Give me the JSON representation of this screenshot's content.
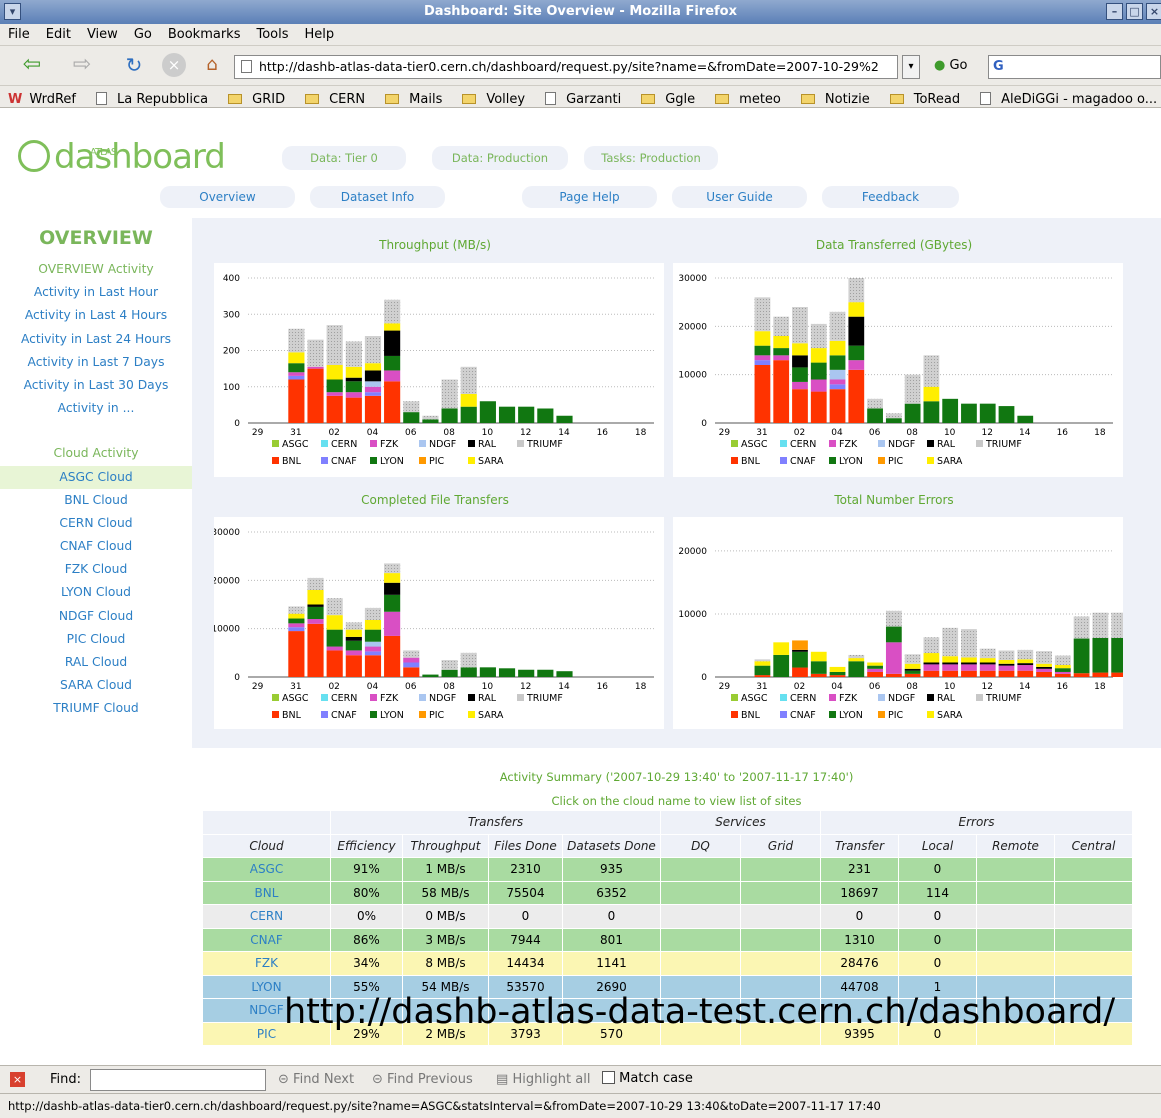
{
  "window": {
    "title": "Dashboard: Site Overview - Mozilla Firefox"
  },
  "menu": [
    "File",
    "Edit",
    "View",
    "Go",
    "Bookmarks",
    "Tools",
    "Help"
  ],
  "nav": {
    "url": "http://dashb-atlas-data-tier0.cern.ch/dashboard/request.py/site?name=&fromDate=2007-10-29%2",
    "go_label": "Go",
    "search_value": "G"
  },
  "bookmarks": [
    {
      "label": "WrdRef",
      "icon": "wr-icon"
    },
    {
      "label": "La Repubblica",
      "icon": "page-icon"
    },
    {
      "label": "GRID",
      "icon": "folder-icon"
    },
    {
      "label": "CERN",
      "icon": "folder-icon"
    },
    {
      "label": "Mails",
      "icon": "folder-icon"
    },
    {
      "label": "Volley",
      "icon": "folder-icon"
    },
    {
      "label": "Garzanti",
      "icon": "page-icon"
    },
    {
      "label": "Ggle",
      "icon": "folder-icon"
    },
    {
      "label": "meteo",
      "icon": "folder-icon"
    },
    {
      "label": "Notizie",
      "icon": "folder-icon"
    },
    {
      "label": "ToRead",
      "icon": "folder-icon"
    },
    {
      "label": "AleDiGGi - magadoo o...",
      "icon": "page-icon"
    }
  ],
  "logo": {
    "small": "ATLAS",
    "text": "dashboard"
  },
  "top_tabs": [
    "Data: Tier 0",
    "Data: Production",
    "Tasks: Production"
  ],
  "nav_tabs": [
    "Overview",
    "Dataset Info",
    "Page Help",
    "User Guide",
    "Feedback"
  ],
  "sidebar": {
    "heading": "OVERVIEW",
    "overview_title": "OVERVIEW Activity",
    "overview_items": [
      "Activity in Last Hour",
      "Activity in Last 4 Hours",
      "Activity in Last 24 Hours",
      "Activity in Last 7 Days",
      "Activity in Last 30 Days",
      "Activity in ..."
    ],
    "cloud_title": "Cloud Activity",
    "cloud_items": [
      "ASGC Cloud",
      "BNL Cloud",
      "CERN Cloud",
      "CNAF Cloud",
      "FZK Cloud",
      "LYON Cloud",
      "NDGF Cloud",
      "PIC Cloud",
      "RAL Cloud",
      "SARA Cloud",
      "TRIUMF Cloud"
    ],
    "selected": "ASGC Cloud"
  },
  "colors": {
    "BNL": "#ff3300",
    "CNAF": "#8080ff",
    "LYON": "#117711",
    "PIC": "#ff9900",
    "SARA": "#ffee00",
    "ASGC": "#99cc33",
    "CERN": "#66e0f0",
    "FZK": "#d94fc4",
    "NDGF": "#aac6f0",
    "RAL": "#000000",
    "TRIUMF": "#c8c8c8"
  },
  "chart_data": [
    {
      "type": "bar",
      "title": "Throughput (MB/s)",
      "x_ticks": [
        "29",
        "31",
        "02",
        "04",
        "06",
        "08",
        "10",
        "12",
        "14",
        "16",
        "18"
      ],
      "y_ticks": [
        0,
        100,
        200,
        300,
        400
      ],
      "ylim": [
        0,
        400
      ],
      "grid": true,
      "legend": "bottom",
      "legend_rows": [
        [
          "ASGC",
          "CERN",
          "FZK",
          "NDGF",
          "RAL",
          "TRIUMF"
        ],
        [
          "BNL",
          "CNAF",
          "LYON",
          "PIC",
          "SARA"
        ]
      ],
      "stacks": [
        {
          "day": "31",
          "BNL": 120,
          "CNAF": 10,
          "FZK": 10,
          "LYON": 25,
          "SARA": 30,
          "TRIUMF": 65
        },
        {
          "day": "01",
          "BNL": 150,
          "FZK": 5,
          "TRIUMF": 75
        },
        {
          "day": "02",
          "BNL": 75,
          "FZK": 10,
          "LYON": 35,
          "SARA": 40,
          "TRIUMF": 110
        },
        {
          "day": "03",
          "BNL": 70,
          "FZK": 15,
          "LYON": 30,
          "RAL": 10,
          "SARA": 30,
          "TRIUMF": 70
        },
        {
          "day": "04",
          "BNL": 75,
          "CNAF": 10,
          "FZK": 15,
          "NDGF": 15,
          "RAL": 30,
          "SARA": 20,
          "TRIUMF": 75
        },
        {
          "day": "05",
          "BNL": 115,
          "FZK": 30,
          "LYON": 40,
          "RAL": 70,
          "SARA": 20,
          "TRIUMF": 65
        },
        {
          "day": "06",
          "LYON": 30,
          "TRIUMF": 30
        },
        {
          "day": "07",
          "LYON": 10,
          "TRIUMF": 10
        },
        {
          "day": "08",
          "LYON": 40,
          "TRIUMF": 80
        },
        {
          "day": "09",
          "LYON": 45,
          "SARA": 35,
          "TRIUMF": 75
        },
        {
          "day": "10",
          "LYON": 60
        },
        {
          "day": "11",
          "LYON": 45
        },
        {
          "day": "12",
          "LYON": 45
        },
        {
          "day": "13",
          "LYON": 40
        },
        {
          "day": "14",
          "LYON": 20
        }
      ]
    },
    {
      "type": "bar",
      "title": "Data Transferred (GBytes)",
      "x_ticks": [
        "29",
        "31",
        "02",
        "04",
        "06",
        "08",
        "10",
        "12",
        "14",
        "16",
        "18"
      ],
      "y_ticks": [
        0,
        10000,
        20000,
        30000
      ],
      "ylim": [
        0,
        30000
      ],
      "grid": true,
      "legend": "bottom",
      "legend_rows": [
        [
          "ASGC",
          "CERN",
          "FZK",
          "NDGF",
          "RAL",
          "TRIUMF"
        ],
        [
          "BNL",
          "CNAF",
          "LYON",
          "PIC",
          "SARA"
        ]
      ],
      "stacks": [
        {
          "day": "31",
          "BNL": 12000,
          "CNAF": 1000,
          "FZK": 1000,
          "LYON": 2000,
          "SARA": 3000,
          "TRIUMF": 7000
        },
        {
          "day": "01",
          "BNL": 13000,
          "FZK": 1000,
          "LYON": 1500,
          "SARA": 2500,
          "TRIUMF": 4000
        },
        {
          "day": "02",
          "BNL": 7000,
          "FZK": 1500,
          "LYON": 3000,
          "RAL": 2500,
          "SARA": 2500,
          "TRIUMF": 7500
        },
        {
          "day": "03",
          "BNL": 6500,
          "FZK": 2500,
          "LYON": 3500,
          "SARA": 3000,
          "TRIUMF": 5000
        },
        {
          "day": "04",
          "BNL": 7000,
          "CNAF": 1000,
          "FZK": 1000,
          "NDGF": 2000,
          "LYON": 3000,
          "SARA": 3000,
          "TRIUMF": 6000
        },
        {
          "day": "05",
          "BNL": 11000,
          "FZK": 2000,
          "LYON": 3000,
          "RAL": 6000,
          "SARA": 3000,
          "TRIUMF": 5000
        },
        {
          "day": "06",
          "LYON": 3000,
          "TRIUMF": 2000
        },
        {
          "day": "07",
          "LYON": 1000,
          "TRIUMF": 1000
        },
        {
          "day": "08",
          "LYON": 4000,
          "TRIUMF": 6000
        },
        {
          "day": "09",
          "LYON": 4500,
          "SARA": 3000,
          "TRIUMF": 6500
        },
        {
          "day": "10",
          "LYON": 5000
        },
        {
          "day": "11",
          "LYON": 4000
        },
        {
          "day": "12",
          "LYON": 4000
        },
        {
          "day": "13",
          "LYON": 3500
        },
        {
          "day": "14",
          "LYON": 1500
        }
      ]
    },
    {
      "type": "bar",
      "title": "Completed File Transfers",
      "x_ticks": [
        "29",
        "31",
        "02",
        "04",
        "06",
        "08",
        "10",
        "12",
        "14",
        "16",
        "18"
      ],
      "y_ticks": [
        0,
        10000,
        20000,
        30000
      ],
      "ylim": [
        0,
        30000
      ],
      "grid": true,
      "legend": "bottom",
      "legend_rows": [
        [
          "ASGC",
          "CERN",
          "FZK",
          "NDGF",
          "RAL",
          "TRIUMF"
        ],
        [
          "BNL",
          "CNAF",
          "LYON",
          "PIC",
          "SARA"
        ]
      ],
      "stacks": [
        {
          "day": "31",
          "BNL": 9500,
          "CNAF": 800,
          "FZK": 800,
          "LYON": 1000,
          "SARA": 1000,
          "TRIUMF": 1500
        },
        {
          "day": "01",
          "BNL": 11000,
          "FZK": 1000,
          "LYON": 2500,
          "SARA": 3000,
          "RAL": 500,
          "TRIUMF": 2500
        },
        {
          "day": "02",
          "BNL": 5500,
          "FZK": 800,
          "LYON": 3500,
          "SARA": 3000,
          "TRIUMF": 3500
        },
        {
          "day": "03",
          "BNL": 4500,
          "FZK": 1000,
          "LYON": 2000,
          "RAL": 800,
          "SARA": 1500,
          "TRIUMF": 1500
        },
        {
          "day": "04",
          "BNL": 4500,
          "CNAF": 800,
          "FZK": 1000,
          "NDGF": 1000,
          "LYON": 2500,
          "SARA": 2000,
          "TRIUMF": 2500
        },
        {
          "day": "05",
          "BNL": 8500,
          "FZK": 5000,
          "LYON": 3500,
          "RAL": 2500,
          "SARA": 2000,
          "TRIUMF": 2000
        },
        {
          "day": "06",
          "BNL": 2000,
          "CNAF": 1000,
          "FZK": 1000,
          "TRIUMF": 1500
        },
        {
          "day": "07",
          "LYON": 500
        },
        {
          "day": "08",
          "LYON": 1500,
          "TRIUMF": 2000
        },
        {
          "day": "09",
          "LYON": 2000,
          "TRIUMF": 3000
        },
        {
          "day": "10",
          "LYON": 2000
        },
        {
          "day": "11",
          "LYON": 1800
        },
        {
          "day": "12",
          "LYON": 1500
        },
        {
          "day": "13",
          "LYON": 1500
        },
        {
          "day": "14",
          "LYON": 1200
        }
      ]
    },
    {
      "type": "bar",
      "title": "Total Number Errors",
      "x_ticks": [
        "29",
        "31",
        "02",
        "04",
        "06",
        "08",
        "10",
        "12",
        "14",
        "16",
        "18"
      ],
      "y_ticks": [
        0,
        10000,
        20000
      ],
      "ylim": [
        0,
        23000
      ],
      "grid": true,
      "legend": "bottom",
      "legend_rows": [
        [
          "ASGC",
          "CERN",
          "FZK",
          "NDGF",
          "RAL",
          "TRIUMF"
        ],
        [
          "BNL",
          "CNAF",
          "LYON",
          "PIC",
          "SARA"
        ]
      ],
      "stacks": [
        {
          "day": "31",
          "BNL": 300,
          "LYON": 1500,
          "SARA": 700,
          "TRIUMF": 300
        },
        {
          "day": "01",
          "LYON": 3500,
          "SARA": 2000
        },
        {
          "day": "02",
          "BNL": 1500,
          "LYON": 2500,
          "PIC": 1500,
          "RAL": 300
        },
        {
          "day": "03",
          "BNL": 500,
          "LYON": 2000,
          "SARA": 1500
        },
        {
          "day": "04",
          "BNL": 300,
          "LYON": 500,
          "SARA": 800
        },
        {
          "day": "05",
          "LYON": 2500,
          "SARA": 500,
          "TRIUMF": 500
        },
        {
          "day": "06",
          "BNL": 800,
          "FZK": 500,
          "LYON": 500,
          "SARA": 500
        },
        {
          "day": "07",
          "BNL": 500,
          "FZK": 5000,
          "LYON": 2500,
          "TRIUMF": 2500
        },
        {
          "day": "08",
          "BNL": 500,
          "LYON": 500,
          "RAL": 300,
          "SARA": 800,
          "TRIUMF": 1500
        },
        {
          "day": "09",
          "BNL": 1000,
          "FZK": 1000,
          "RAL": 300,
          "SARA": 1500,
          "TRIUMF": 2500
        },
        {
          "day": "10",
          "BNL": 1000,
          "FZK": 1000,
          "RAL": 300,
          "SARA": 1000,
          "TRIUMF": 4500
        },
        {
          "day": "11",
          "BNL": 1000,
          "FZK": 1000,
          "RAL": 300,
          "SARA": 800,
          "TRIUMF": 4500
        },
        {
          "day": "12",
          "BNL": 1000,
          "FZK": 1000,
          "RAL": 300,
          "SARA": 700,
          "TRIUMF": 1500
        },
        {
          "day": "13",
          "BNL": 1000,
          "FZK": 800,
          "RAL": 300,
          "SARA": 600,
          "TRIUMF": 1500
        },
        {
          "day": "14",
          "BNL": 1000,
          "FZK": 900,
          "RAL": 300,
          "SARA": 600,
          "TRIUMF": 1500
        },
        {
          "day": "15",
          "BNL": 800,
          "FZK": 500,
          "RAL": 300,
          "SARA": 500,
          "TRIUMF": 2000
        },
        {
          "day": "16",
          "BNL": 500,
          "FZK": 300,
          "LYON": 600,
          "SARA": 500,
          "TRIUMF": 1500
        },
        {
          "day": "17",
          "BNL": 600,
          "LYON": 5500,
          "TRIUMF": 3500
        },
        {
          "day": "18",
          "BNL": 700,
          "LYON": 5500,
          "TRIUMF": 4000
        },
        {
          "day": "19",
          "BNL": 700,
          "LYON": 5500,
          "TRIUMF": 4000
        }
      ]
    }
  ],
  "summary": {
    "title": "Activity Summary ('2007-10-29 13:40' to '2007-11-17 17:40')",
    "subtitle": "Click on the cloud name to view list of sites",
    "groups": [
      "",
      "Transfers",
      "Services",
      "Errors"
    ],
    "columns": [
      "Cloud",
      "Efficiency",
      "Throughput",
      "Files Done",
      "Datasets Done",
      "DQ",
      "Grid",
      "Transfer",
      "Local",
      "Remote",
      "Central"
    ],
    "rows": [
      {
        "style": "g",
        "cells": [
          "ASGC",
          "91%",
          "1 MB/s",
          "2310",
          "935",
          "",
          "",
          "231",
          "0",
          "",
          ""
        ]
      },
      {
        "style": "g",
        "cells": [
          "BNL",
          "80%",
          "58 MB/s",
          "75504",
          "6352",
          "",
          "",
          "18697",
          "114",
          "",
          ""
        ]
      },
      {
        "style": "w",
        "cells": [
          "CERN",
          "0%",
          "0 MB/s",
          "0",
          "0",
          "",
          "",
          "0",
          "0",
          "",
          ""
        ]
      },
      {
        "style": "g",
        "cells": [
          "CNAF",
          "86%",
          "3 MB/s",
          "7944",
          "801",
          "",
          "",
          "1310",
          "0",
          "",
          ""
        ]
      },
      {
        "style": "y",
        "cells": [
          "FZK",
          "34%",
          "8 MB/s",
          "14434",
          "1141",
          "",
          "",
          "28476",
          "0",
          "",
          ""
        ]
      },
      {
        "style": "b",
        "cells": [
          "LYON",
          "55%",
          "54 MB/s",
          "53570",
          "2690",
          "",
          "",
          "44708",
          "1",
          "",
          ""
        ]
      },
      {
        "style": "b",
        "cells": [
          "NDGF",
          "",
          "",
          "",
          "",
          "",
          "",
          "",
          "",
          "",
          ""
        ]
      },
      {
        "style": "y",
        "cells": [
          "PIC",
          "29%",
          "2 MB/s",
          "3793",
          "570",
          "",
          "",
          "9395",
          "0",
          "",
          ""
        ]
      }
    ]
  },
  "overlay_url": "http://dashb-atlas-data-test.cern.ch/dashboard/",
  "findbar": {
    "label": "Find:",
    "next": "Find Next",
    "previous": "Find Previous",
    "highlight": "Highlight all",
    "match_case": "Match case"
  },
  "status": "http://dashb-atlas-data-tier0.cern.ch/dashboard/request.py/site?name=ASGC&statsInterval=&fromDate=2007-10-29 13:40&toDate=2007-11-17 17:40"
}
